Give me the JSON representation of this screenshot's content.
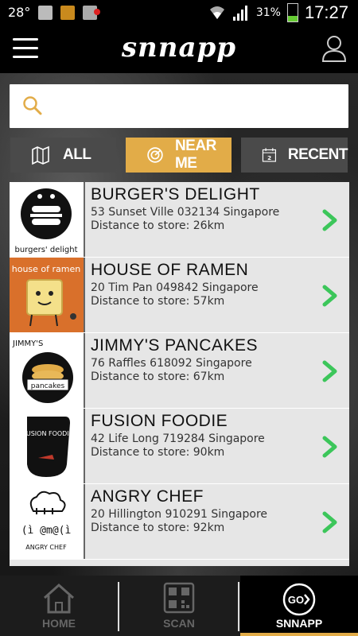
{
  "status_bar": {
    "temperature": "28°",
    "battery_percent": "31%",
    "time": "17:27"
  },
  "header": {
    "app_name": "snnapp"
  },
  "search": {
    "placeholder": "",
    "value": ""
  },
  "filters": {
    "all": "ALL",
    "near_me": "NEAR ME",
    "recent": "RECENT",
    "recent_icon_number": "2",
    "active": "near_me"
  },
  "colors": {
    "accent": "#e2ac48",
    "chevron": "#3cc65a",
    "tab_inactive": "#4a4a4a"
  },
  "stores": [
    {
      "name": "BURGER'S DELIGHT",
      "address": "53 Sunset Ville 032134 Singapore",
      "distance": "Distance to store: 26km",
      "logo_text": "burgers' delight"
    },
    {
      "name": "HOUSE OF RAMEN",
      "address": "20 Tim Pan 049842 Singapore",
      "distance": "Distance to store: 57km",
      "logo_text": "house of ramen"
    },
    {
      "name": "JIMMY'S PANCAKES",
      "address": "76 Raffles 618092 Singapore",
      "distance": "Distance to store: 67km",
      "logo_text": "pancakes",
      "logo_top_text": "JIMMY'S"
    },
    {
      "name": "FUSION FOODIE",
      "address": "42 Life Long 719284 Singapore",
      "distance": "Distance to store: 90km",
      "logo_text": "FUSION FOODIE"
    },
    {
      "name": "ANGRY CHEF",
      "address": "20 Hillington 910291 Singapore",
      "distance": "Distance to store: 92km",
      "logo_text": "(ì @m@(ì",
      "logo_sub_text": "ANGRY CHEF"
    }
  ],
  "bottom_nav": {
    "home": "HOME",
    "scan": "SCAN",
    "snnapp": "SNNAPP",
    "snnapp_icon_text": "GO",
    "active": "snnapp"
  }
}
